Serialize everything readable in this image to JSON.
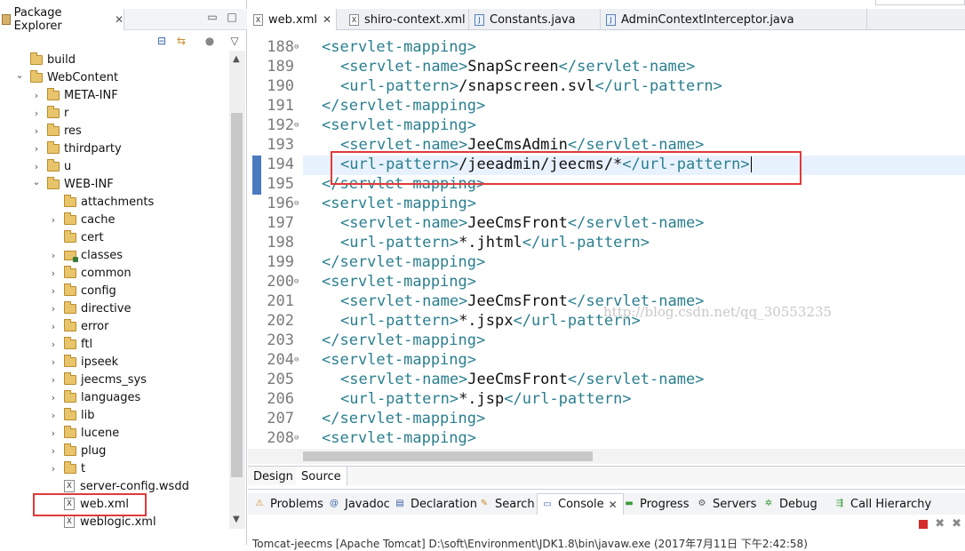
{
  "package_explorer": {
    "tab_label": "Package Explorer",
    "tree": [
      {
        "label": "build",
        "depth": 0,
        "expanded": false,
        "kind": "folder",
        "has_chevron": false
      },
      {
        "label": "WebContent",
        "depth": 0,
        "expanded": true,
        "kind": "folder",
        "has_chevron": true
      },
      {
        "label": "META-INF",
        "depth": 1,
        "expanded": false,
        "kind": "folder",
        "has_chevron": true
      },
      {
        "label": "r",
        "depth": 1,
        "expanded": false,
        "kind": "folder",
        "has_chevron": true
      },
      {
        "label": "res",
        "depth": 1,
        "expanded": false,
        "kind": "folder",
        "has_chevron": true
      },
      {
        "label": "thirdparty",
        "depth": 1,
        "expanded": false,
        "kind": "folder",
        "has_chevron": true
      },
      {
        "label": "u",
        "depth": 1,
        "expanded": false,
        "kind": "folder",
        "has_chevron": true
      },
      {
        "label": "WEB-INF",
        "depth": 1,
        "expanded": true,
        "kind": "folder",
        "has_chevron": true
      },
      {
        "label": "attachments",
        "depth": 2,
        "expanded": false,
        "kind": "folder",
        "has_chevron": false
      },
      {
        "label": "cache",
        "depth": 2,
        "expanded": false,
        "kind": "folder",
        "has_chevron": true
      },
      {
        "label": "cert",
        "depth": 2,
        "expanded": false,
        "kind": "folder",
        "has_chevron": false
      },
      {
        "label": "classes",
        "depth": 2,
        "expanded": false,
        "kind": "project-folder",
        "has_chevron": true
      },
      {
        "label": "common",
        "depth": 2,
        "expanded": false,
        "kind": "folder",
        "has_chevron": true
      },
      {
        "label": "config",
        "depth": 2,
        "expanded": false,
        "kind": "folder",
        "has_chevron": true
      },
      {
        "label": "directive",
        "depth": 2,
        "expanded": false,
        "kind": "folder",
        "has_chevron": true
      },
      {
        "label": "error",
        "depth": 2,
        "expanded": false,
        "kind": "folder",
        "has_chevron": true
      },
      {
        "label": "ftl",
        "depth": 2,
        "expanded": false,
        "kind": "folder",
        "has_chevron": true
      },
      {
        "label": "ipseek",
        "depth": 2,
        "expanded": false,
        "kind": "folder",
        "has_chevron": true
      },
      {
        "label": "jeecms_sys",
        "depth": 2,
        "expanded": false,
        "kind": "folder",
        "has_chevron": true
      },
      {
        "label": "languages",
        "depth": 2,
        "expanded": false,
        "kind": "folder",
        "has_chevron": true
      },
      {
        "label": "lib",
        "depth": 2,
        "expanded": false,
        "kind": "folder",
        "has_chevron": true
      },
      {
        "label": "lucene",
        "depth": 2,
        "expanded": false,
        "kind": "folder",
        "has_chevron": true
      },
      {
        "label": "plug",
        "depth": 2,
        "expanded": false,
        "kind": "folder",
        "has_chevron": true
      },
      {
        "label": "t",
        "depth": 2,
        "expanded": false,
        "kind": "folder",
        "has_chevron": true
      },
      {
        "label": "server-config.wsdd",
        "depth": 2,
        "expanded": false,
        "kind": "xfile",
        "has_chevron": false
      },
      {
        "label": "web.xml",
        "depth": 2,
        "expanded": false,
        "kind": "xfile",
        "has_chevron": false
      },
      {
        "label": "weblogic.xml",
        "depth": 2,
        "expanded": false,
        "kind": "xfile",
        "has_chevron": false
      }
    ]
  },
  "editor": {
    "tabs": [
      {
        "label": "web.xml",
        "active": true,
        "closable": true,
        "icon": "xml-file-icon"
      },
      {
        "label": "shiro-context.xml",
        "active": false,
        "closable": false,
        "icon": "xml-file-icon"
      },
      {
        "label": "Constants.java",
        "active": false,
        "closable": false,
        "icon": "java-file-icon"
      },
      {
        "label": "AdminContextInterceptor.java",
        "active": false,
        "closable": false,
        "icon": "java-file-icon"
      }
    ],
    "lines": [
      {
        "n": "188",
        "fold": true,
        "indent": 1,
        "tag": "servlet-mapping",
        "kind": "open"
      },
      {
        "n": "189",
        "fold": false,
        "indent": 2,
        "tag": "servlet-name",
        "kind": "elem",
        "value": "SnapScreen"
      },
      {
        "n": "190",
        "fold": false,
        "indent": 2,
        "tag": "url-pattern",
        "kind": "elem",
        "value": "/snapscreen.svl"
      },
      {
        "n": "191",
        "fold": false,
        "indent": 1,
        "tag": "servlet-mapping",
        "kind": "close"
      },
      {
        "n": "192",
        "fold": true,
        "indent": 1,
        "tag": "servlet-mapping",
        "kind": "open"
      },
      {
        "n": "193",
        "fold": false,
        "indent": 2,
        "tag": "servlet-name",
        "kind": "elem",
        "value": "JeeCmsAdmin"
      },
      {
        "n": "194",
        "fold": false,
        "indent": 2,
        "tag": "url-pattern",
        "kind": "elem",
        "value": "/jeeadmin/jeecms/*",
        "current": true
      },
      {
        "n": "195",
        "fold": false,
        "indent": 1,
        "tag": "servlet-mapping",
        "kind": "close"
      },
      {
        "n": "196",
        "fold": true,
        "indent": 1,
        "tag": "servlet-mapping",
        "kind": "open"
      },
      {
        "n": "197",
        "fold": false,
        "indent": 2,
        "tag": "servlet-name",
        "kind": "elem",
        "value": "JeeCmsFront"
      },
      {
        "n": "198",
        "fold": false,
        "indent": 2,
        "tag": "url-pattern",
        "kind": "elem",
        "value": "*.jhtml"
      },
      {
        "n": "199",
        "fold": false,
        "indent": 1,
        "tag": "servlet-mapping",
        "kind": "close"
      },
      {
        "n": "200",
        "fold": true,
        "indent": 1,
        "tag": "servlet-mapping",
        "kind": "open"
      },
      {
        "n": "201",
        "fold": false,
        "indent": 2,
        "tag": "servlet-name",
        "kind": "elem",
        "value": "JeeCmsFront"
      },
      {
        "n": "202",
        "fold": false,
        "indent": 2,
        "tag": "url-pattern",
        "kind": "elem",
        "value": "*.jspx"
      },
      {
        "n": "203",
        "fold": false,
        "indent": 1,
        "tag": "servlet-mapping",
        "kind": "close"
      },
      {
        "n": "204",
        "fold": true,
        "indent": 1,
        "tag": "servlet-mapping",
        "kind": "open"
      },
      {
        "n": "205",
        "fold": false,
        "indent": 2,
        "tag": "servlet-name",
        "kind": "elem",
        "value": "JeeCmsFront"
      },
      {
        "n": "206",
        "fold": false,
        "indent": 2,
        "tag": "url-pattern",
        "kind": "elem",
        "value": "*.jsp"
      },
      {
        "n": "207",
        "fold": false,
        "indent": 1,
        "tag": "servlet-mapping",
        "kind": "close"
      },
      {
        "n": "208",
        "fold": true,
        "indent": 1,
        "tag": "servlet-mapping",
        "kind": "open"
      }
    ],
    "watermark": "http://blog.csdn.net/qq_30553235",
    "bottom_tabs": [
      {
        "label": "Design",
        "active": false
      },
      {
        "label": "Source",
        "active": true
      }
    ]
  },
  "console": {
    "tabs": [
      {
        "label": "Problems",
        "icon": "problems-icon",
        "active": false
      },
      {
        "label": "Javadoc",
        "icon": "javadoc-icon",
        "active": false
      },
      {
        "label": "Declaration",
        "icon": "declaration-icon",
        "active": false
      },
      {
        "label": "Search",
        "icon": "search-icon",
        "active": false
      },
      {
        "label": "Console",
        "icon": "console-icon",
        "active": true
      },
      {
        "label": "Progress",
        "icon": "progress-icon",
        "active": false
      },
      {
        "label": "Servers",
        "icon": "servers-icon",
        "active": false
      },
      {
        "label": "Debug",
        "icon": "debug-icon",
        "active": false
      },
      {
        "label": "Call Hierarchy",
        "icon": "call-hierarchy-icon",
        "active": false
      }
    ],
    "status_line": "Tomcat-jeecms [Apache Tomcat] D:\\soft\\Environment\\JDK1.8\\bin\\javaw.exe (2017年7月11日 下午2:42:58)"
  },
  "colors": {
    "highlight_box": "#e03a3a",
    "xml_tag": "#2a7f8e",
    "current_line": "#e8f2fe"
  }
}
